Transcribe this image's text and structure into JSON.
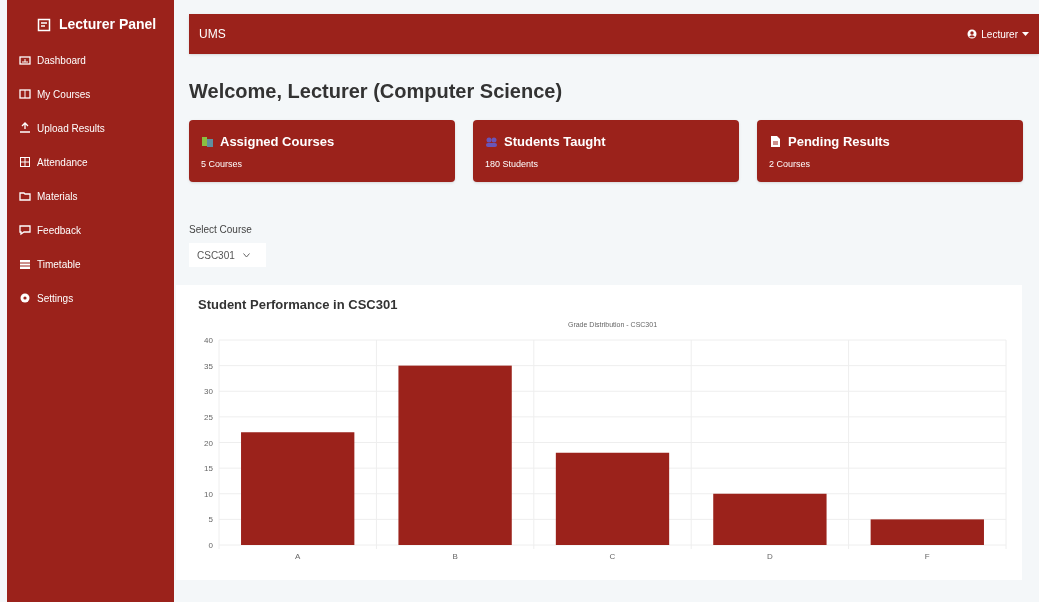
{
  "sidebar": {
    "title": "Lecturer Panel",
    "items": [
      {
        "label": "Dashboard"
      },
      {
        "label": "My Courses"
      },
      {
        "label": "Upload Results"
      },
      {
        "label": "Attendance"
      },
      {
        "label": "Materials"
      },
      {
        "label": "Feedback"
      },
      {
        "label": "Timetable"
      },
      {
        "label": "Settings"
      }
    ]
  },
  "navbar": {
    "brand": "UMS",
    "user": "Lecturer"
  },
  "heading": "Welcome, Lecturer (Computer Science)",
  "cards": [
    {
      "title": "Assigned Courses",
      "value": "5 Courses"
    },
    {
      "title": "Students Taught",
      "value": "180 Students"
    },
    {
      "title": "Pending Results",
      "value": "2 Courses"
    }
  ],
  "course_select": {
    "label": "Select Course",
    "value": "CSC301"
  },
  "performance": {
    "title": "Student Performance in CSC301",
    "chart_data": {
      "type": "bar",
      "title": "Grade Distribution - CSC301",
      "categories": [
        "A",
        "B",
        "C",
        "D",
        "F"
      ],
      "series": [
        {
          "color": "#9b221b",
          "values": [
            22,
            35,
            18,
            10,
            5
          ]
        }
      ],
      "ylim": [
        0,
        40
      ],
      "yticks": [
        0,
        5,
        10,
        15,
        20,
        25,
        30,
        35,
        40
      ],
      "grid": true
    }
  }
}
